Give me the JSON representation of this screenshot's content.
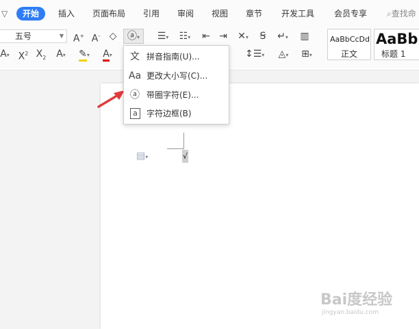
{
  "tabs": {
    "menu_caret": "▽",
    "items": [
      "开始",
      "插入",
      "页面布局",
      "引用",
      "审阅",
      "视图",
      "章节",
      "开发工具",
      "会员专享"
    ],
    "search_label": "查找命"
  },
  "ribbon": {
    "font_size_value": "五号",
    "styles": [
      {
        "preview": "AaBbCcDd",
        "name": "正文"
      },
      {
        "preview": "AaBb",
        "name": "标题 1"
      }
    ]
  },
  "menu": {
    "items": [
      {
        "icon": "pinyin-icon",
        "glyph": "文",
        "label": "拼音指南(U)..."
      },
      {
        "icon": "change-case-icon",
        "glyph": "Aa",
        "label": "更改大小写(C)..."
      },
      {
        "icon": "enclosed-char-icon",
        "glyph": "ⓐ",
        "label": "带圈字符(E)..."
      },
      {
        "icon": "char-border-icon",
        "glyph": "a",
        "label": "字符边框(B)"
      }
    ]
  },
  "document": {
    "cursor_char": "√"
  },
  "watermark": {
    "brand": "Bai度经验",
    "url": "jingyan.baidu.com"
  },
  "colors": {
    "accent": "#2f7df6",
    "arrow": "#e03c3c"
  }
}
